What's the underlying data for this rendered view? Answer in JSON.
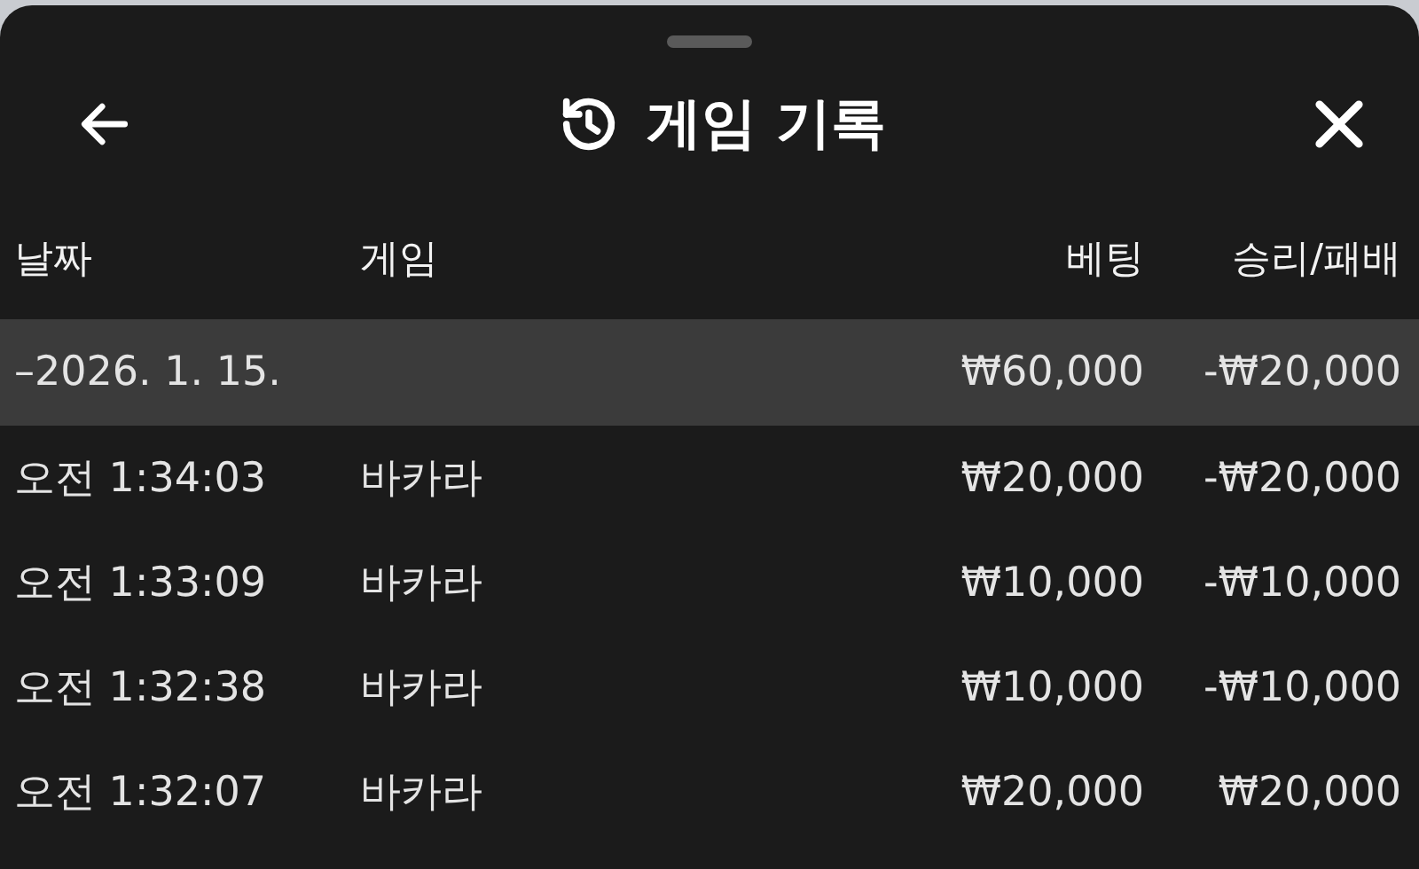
{
  "header": {
    "title": "게임 기록"
  },
  "table": {
    "columns": [
      "날짜",
      "게임",
      "베팅",
      "승리/패배"
    ],
    "group": {
      "date": "–2026. 1. 15.",
      "bet": "₩60,000",
      "result": "-₩20,000"
    },
    "rows": [
      {
        "time": "오전 1:34:03",
        "game": "바카라",
        "bet": "₩20,000",
        "result": "-₩20,000"
      },
      {
        "time": "오전 1:33:09",
        "game": "바카라",
        "bet": "₩10,000",
        "result": "-₩10,000"
      },
      {
        "time": "오전 1:32:38",
        "game": "바카라",
        "bet": "₩10,000",
        "result": "-₩10,000"
      },
      {
        "time": "오전 1:32:07",
        "game": "바카라",
        "bet": "₩20,000",
        "result": "₩20,000"
      }
    ]
  }
}
